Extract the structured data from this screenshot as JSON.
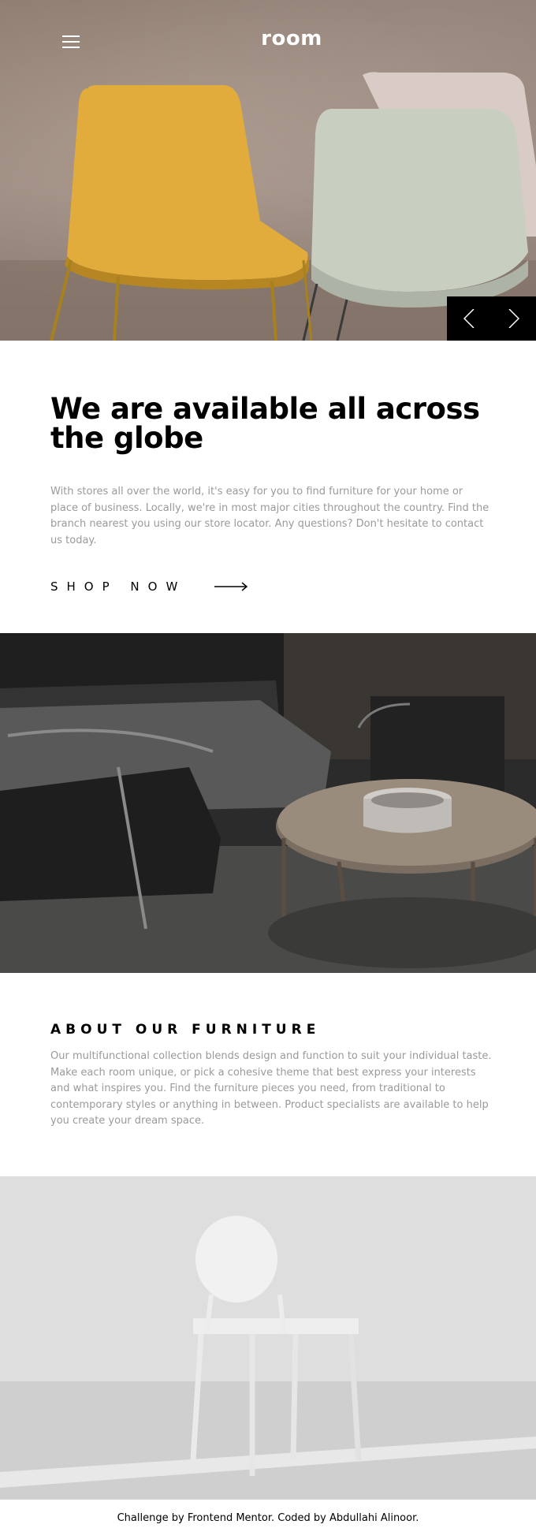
{
  "header": {
    "logo": "room",
    "menu_icon": "hamburger-menu-icon"
  },
  "hero": {
    "prev_icon": "chevron-left-icon",
    "next_icon": "chevron-right-icon"
  },
  "available": {
    "title": "We are available all across the globe",
    "text": "With stores all over the world, it's easy for you to find furniture for your home or place of business. Locally, we're in most major cities throughout the country. Find the branch nearest you using our store locator. Any questions? Don't hesitate to contact us today.",
    "cta_label": "SHOP NOW",
    "cta_icon": "arrow-right-icon"
  },
  "about": {
    "title": "ABOUT OUR FURNITURE",
    "text": "Our multifunctional collection blends design and function to suit your individual taste. Make each room unique, or pick a cohesive theme that best express your interests and what inspires you. Find the furniture pieces you need, from traditional to contemporary styles or anything in between. Product specialists are available to help you create your dream space."
  },
  "footer": {
    "prefix": "Challenge by ",
    "link1": "Frontend Mentor",
    "middle": ". Coded by ",
    "link2": "Abdullahi Alinoor",
    "suffix": "."
  },
  "colors": {
    "body_text": "#9a9a9a",
    "heading": "#000000",
    "slider_bg": "#000000",
    "chair_yellow": "#e5b142",
    "chair_green": "#c9cfc0",
    "chair_pink": "#d9ccc6"
  }
}
